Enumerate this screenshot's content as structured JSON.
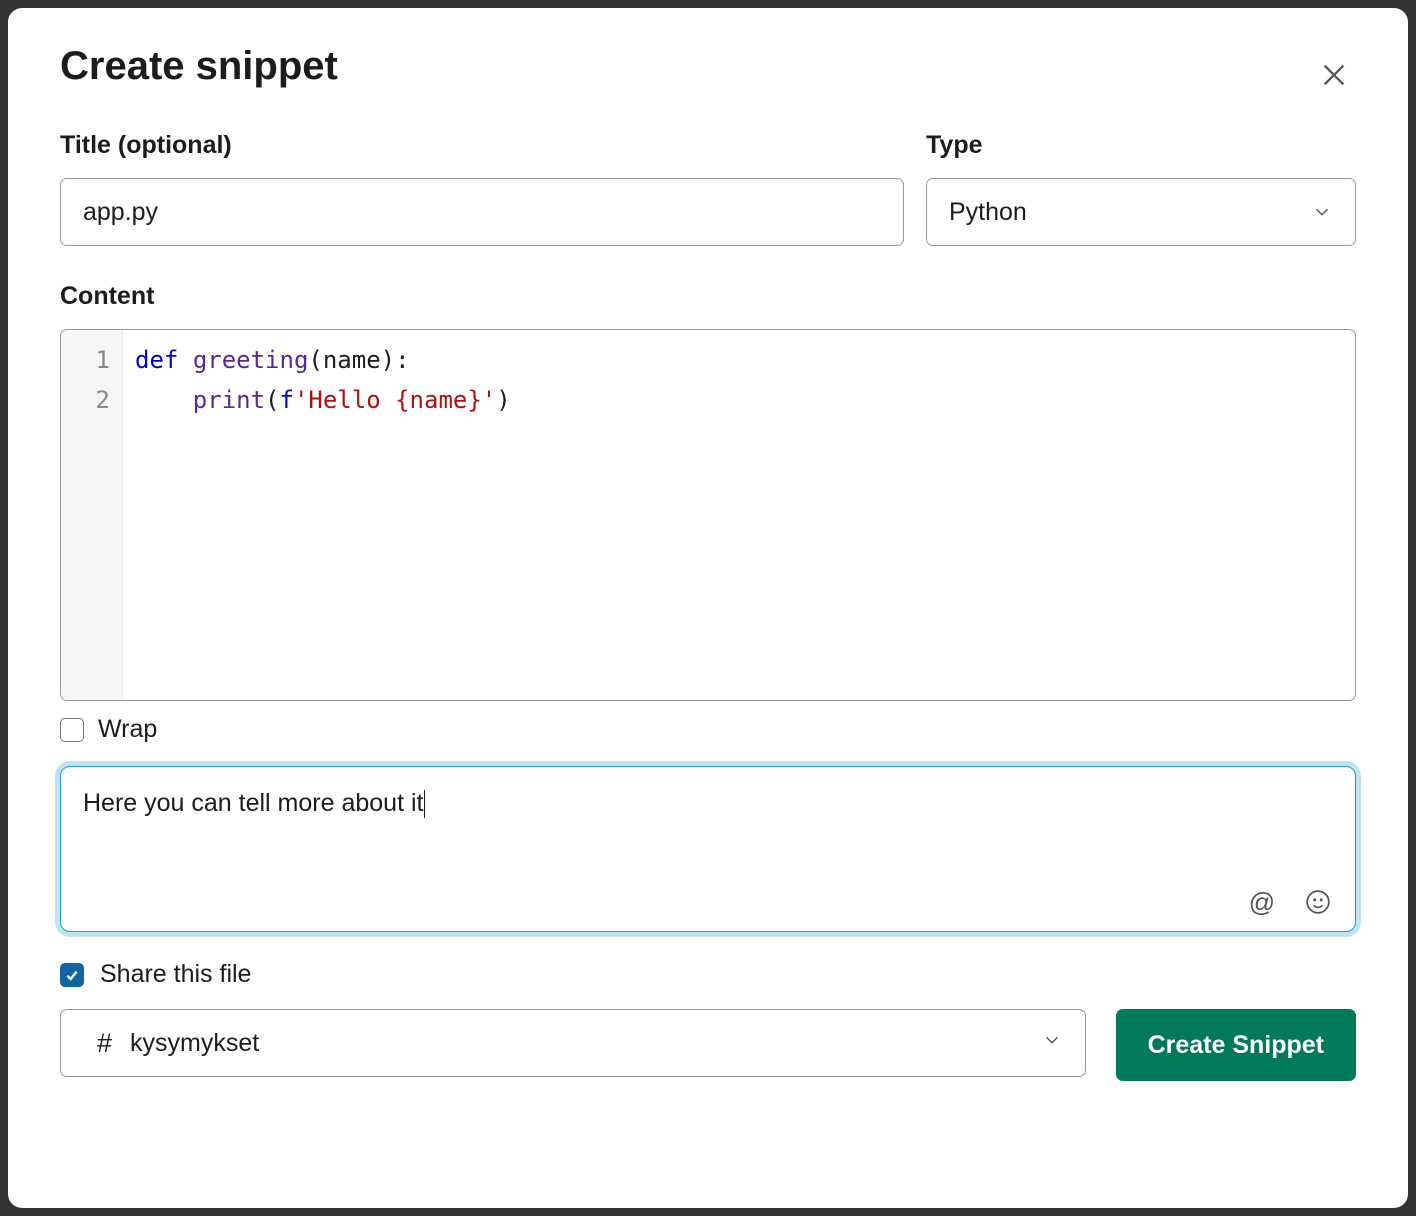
{
  "modal": {
    "title": "Create snippet"
  },
  "fields": {
    "title_label": "Title (optional)",
    "title_value": "app.py",
    "type_label": "Type",
    "type_value": "Python",
    "content_label": "Content",
    "wrap_label": "Wrap",
    "wrap_checked": false,
    "share_label": "Share this file",
    "share_checked": true
  },
  "code": {
    "line1": {
      "kw": "def",
      "fn": "greeting",
      "args": "(name):"
    },
    "line2": {
      "indent": "    ",
      "fn": "print",
      "open": "(",
      "fpre": "f",
      "str": "'Hello {name}'",
      "close": ")"
    },
    "line_numbers": [
      "1",
      "2"
    ]
  },
  "message": {
    "text": "Here you can tell more about it"
  },
  "channel": {
    "prefix": "#",
    "name": "kysymykset"
  },
  "buttons": {
    "create": "Create Snippet"
  }
}
